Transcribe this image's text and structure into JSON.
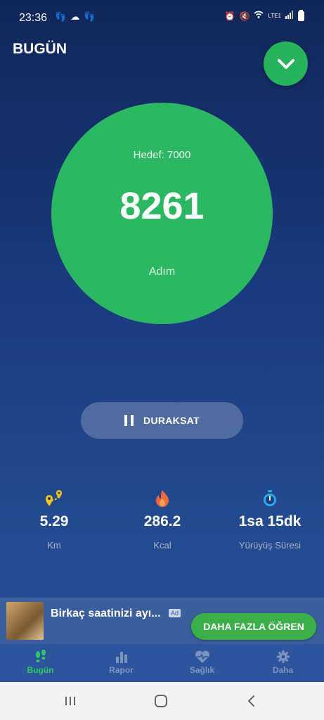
{
  "status_bar": {
    "time": "23:36",
    "network": "LTE1"
  },
  "header": {
    "title": "BUGÜN"
  },
  "steps": {
    "goal_label": "Hedef: 7000",
    "count": "8261",
    "unit": "Adım"
  },
  "controls": {
    "pause_label": "DURAKSAT"
  },
  "stats": [
    {
      "icon": "distance-icon",
      "value": "5.29",
      "label": "Km"
    },
    {
      "icon": "flame-icon",
      "value": "286.2",
      "label": "Kcal"
    },
    {
      "icon": "stopwatch-icon",
      "value": "1sa 15dk",
      "label": "Yürüyüş Süresi"
    }
  ],
  "ad": {
    "text": "Birkaç saatinizi ayı...",
    "tag": "Ad",
    "cta": "DAHA FAZLA ÖĞREN"
  },
  "tabs": [
    {
      "icon": "footsteps-icon",
      "label": "Bugün",
      "active": true
    },
    {
      "icon": "bar-chart-icon",
      "label": "Rapor",
      "active": false
    },
    {
      "icon": "heart-pulse-icon",
      "label": "Sağlık",
      "active": false
    },
    {
      "icon": "gear-icon",
      "label": "Daha",
      "active": false
    }
  ],
  "colors": {
    "accent_green": "#2cb862",
    "background_top": "#102659",
    "background_bottom": "#27509a",
    "tab_bar": "#2c559e",
    "ad_bar": "#3b5f9c"
  }
}
